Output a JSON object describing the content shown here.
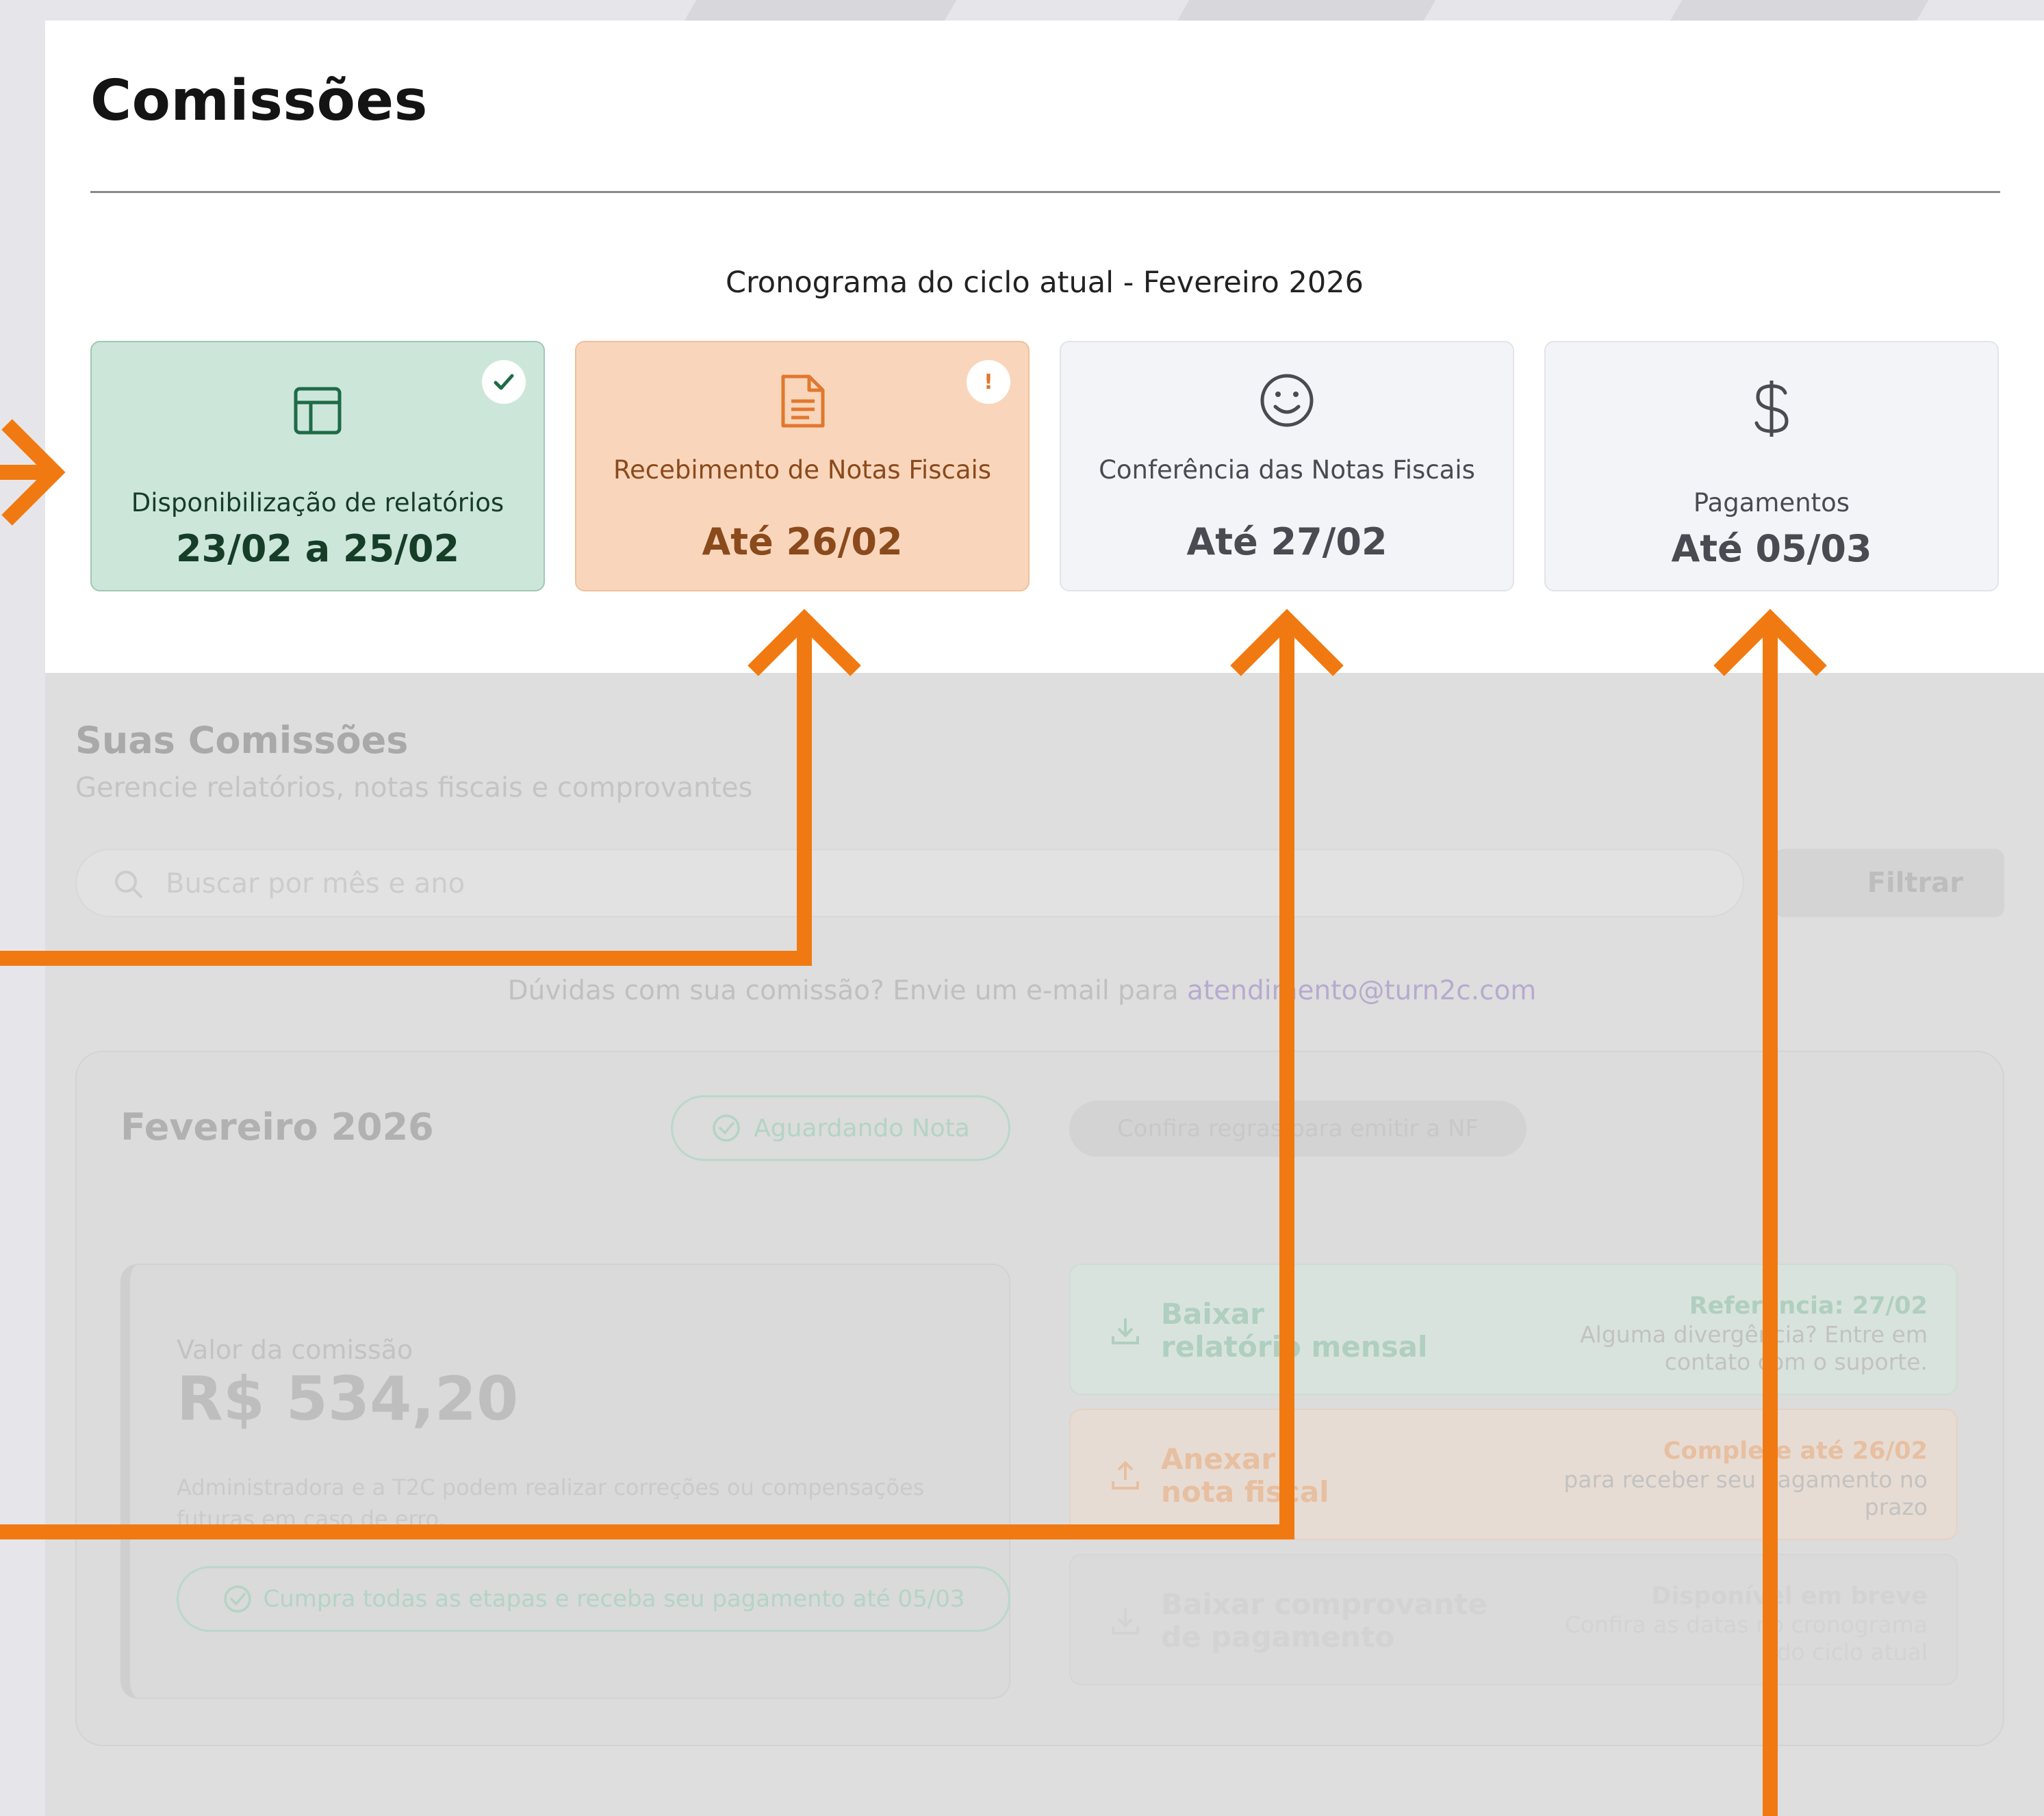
{
  "page_title": "Comissões",
  "schedule": {
    "heading": "Cronograma do ciclo atual - Fevereiro 2026",
    "steps": [
      {
        "label": "Disponibilização de relatórios",
        "date": "23/02 a 25/02",
        "icon": "layout-icon",
        "status": "done",
        "color": "#cde6da"
      },
      {
        "label": "Recebimento de Notas Fiscais",
        "date": "Até 26/02",
        "icon": "document-icon",
        "status": "attention",
        "badge": "!",
        "color": "#f9d6bb"
      },
      {
        "label": "Conferência das Notas Fiscais",
        "date": "Até 27/02",
        "icon": "smile-icon",
        "status": "pending",
        "color": "#f3f4f7"
      },
      {
        "label": "Pagamentos",
        "date": "Até 05/03",
        "icon": "dollar-icon",
        "status": "pending",
        "color": "#f3f4f7"
      }
    ]
  },
  "section": {
    "title": "Suas Comissões",
    "subtitle": "Gerencie relatórios, notas fiscais e comprovantes"
  },
  "search": {
    "placeholder": "Buscar por mês e ano",
    "filter_label": "Filtrar"
  },
  "help": {
    "text": "Dúvidas com sua comissão? Envie um e-mail para ",
    "email": "atendimento@turn2c.com"
  },
  "month_card": {
    "title": "Fevereiro 2026",
    "status_chip": "Aguardando Nota",
    "rules_chip": "Confira regras para emitir a NF",
    "value_label": "Valor da comissão",
    "value_amount": "R$ 534,20",
    "value_note": "Administradora e a T2C podem realizar correções ou compensações futuras em caso de erro.",
    "deadline_chip": "Cumpra todas as etapas e receba seu pagamento até 05/03",
    "actions": [
      {
        "title_1": "Baixar",
        "title_2": "relatório mensal",
        "side_title": "Referência: 27/02",
        "side_desc": "Alguma divergência? Entre em contato com o suporte.",
        "icon": "download-icon"
      },
      {
        "title_1": "Anexar",
        "title_2": "nota fiscal",
        "side_title": "Complete até 26/02",
        "side_desc": "para receber seu pagamento no prazo",
        "icon": "upload-icon"
      },
      {
        "title_1": "Baixar comprovante",
        "title_2": "de pagamento",
        "side_title": "Disponível em breve",
        "side_desc": "Confira as datas no cronograma do ciclo atual",
        "icon": "download-icon"
      }
    ]
  },
  "colors": {
    "accent_orange": "#f07a11",
    "success_green": "#1e6b47",
    "attention_orange": "#e0782e"
  }
}
